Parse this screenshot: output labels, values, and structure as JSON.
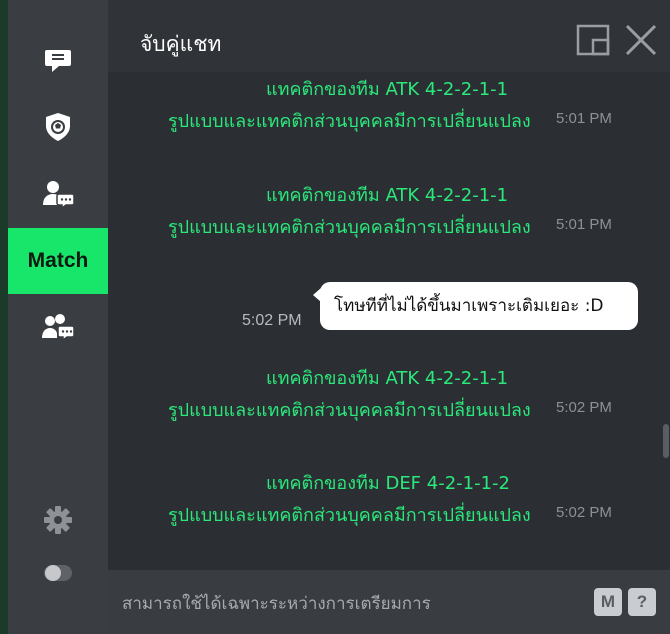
{
  "window": {
    "title": "จับคู่แชท"
  },
  "sidebar": {
    "items": [
      {
        "name": "chat",
        "icon": "chat-bubble-icon"
      },
      {
        "name": "club",
        "icon": "shield-ball-icon"
      },
      {
        "name": "friend-chat",
        "icon": "user-chat-icon"
      },
      {
        "name": "match",
        "label": "Match"
      },
      {
        "name": "group-chat",
        "icon": "group-chat-icon"
      }
    ],
    "settings_icon": "gear-icon",
    "toggle_icon": "toggle-icon",
    "active_color": "#18e66a"
  },
  "header": {
    "popout_icon": "popout-icon",
    "close_icon": "close-icon"
  },
  "messages": [
    {
      "line1": "แทคติกของทีม ATK 4-2-2-1-1",
      "line2": "รูปแบบและแทคติกส่วนบุคคลมีการเปลี่ยนแปลง",
      "time": "5:01 PM"
    },
    {
      "line1": "แทคติกของทีม ATK 4-2-2-1-1",
      "line2": "รูปแบบและแทคติกส่วนบุคคลมีการเปลี่ยนแปลง",
      "time": "5:01 PM"
    },
    {
      "user_text": "โทษทีที่ไม่ได้ขึ้นมาเพราะเติมเยอะ :D",
      "time": "5:02 PM"
    },
    {
      "line1": "แทคติกของทีม ATK 4-2-2-1-1",
      "line2": "รูปแบบและแทคติกส่วนบุคคลมีการเปลี่ยนแปลง",
      "time": "5:02 PM"
    },
    {
      "line1": "แทคติกของทีม DEF 4-2-1-1-2",
      "line2": "รูปแบบและแทคติกส่วนบุคคลมีการเปลี่ยนแปลง",
      "time": "5:02 PM"
    }
  ],
  "input": {
    "placeholder": "สามารถใช้ได้เฉพาะระหว่างการเตรียมการ",
    "macro_label": "M",
    "help_label": "?"
  },
  "colors": {
    "system_text": "#2be87a",
    "background": "#2b2f34"
  }
}
